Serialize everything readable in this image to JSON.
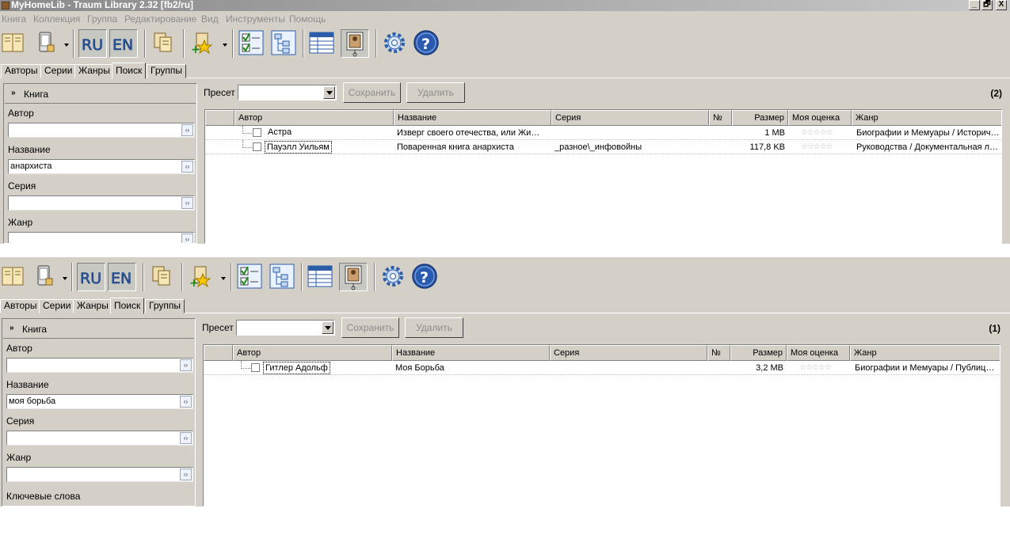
{
  "window": {
    "title": "MyHomeLib - Traum Library 2.32 [fb2/ru]",
    "minimize": "_",
    "restore": "🗗",
    "close": "X"
  },
  "menu": [
    "Книга",
    "Коллекция",
    "Группа",
    "Редактирование",
    "Вид",
    "Инструменты",
    "Помощь"
  ],
  "toolbar": {
    "lang_ru": "RU",
    "lang_en": "EN",
    "help": "?",
    "icons": [
      "book-icon",
      "device-icon",
      "ru-language-icon",
      "en-language-icon",
      "copy-icon",
      "add-favorite-icon",
      "check-list-icon",
      "tree-view-icon",
      "table-view-icon",
      "cover-view-icon",
      "settings-gear-icon",
      "help-icon"
    ]
  },
  "tabs": [
    "Авторы",
    "Серии",
    "Жанры",
    "Поиск",
    "Группы"
  ],
  "columns": {
    "author": "Автор",
    "title": "Название",
    "series": "Серия",
    "num": "№",
    "size": "Размер",
    "rating": "Моя оценка",
    "genre": "Жанр"
  },
  "panes": [
    {
      "left_header": "Книга",
      "fields": [
        {
          "label": "Автор",
          "value": ""
        },
        {
          "label": "Название",
          "value": "анархиста"
        },
        {
          "label": "Серия",
          "value": ""
        },
        {
          "label": "Жанр",
          "value": ""
        }
      ],
      "preset_label": "Пресет",
      "save_label": "Сохранить",
      "delete_label": "Удалить",
      "count": "(2)",
      "rows": [
        {
          "author": "Астра",
          "title": "Изверг своего отечества, или Жи…",
          "series": "",
          "num": "",
          "size": "1 MB",
          "rating": "☆☆☆☆☆",
          "genre": "Биографии и Мемуары / Историчес…"
        },
        {
          "author": "Пауэлл Уильям",
          "title": "Поваренная книга анархиста",
          "series": "_разное\\_инфовойны",
          "num": "",
          "size": "117,8 KB",
          "rating": "☆☆☆☆☆",
          "genre": "Руководства / Документальная л…"
        }
      ]
    },
    {
      "left_header": "Книга",
      "fields": [
        {
          "label": "Автор",
          "value": ""
        },
        {
          "label": "Название",
          "value": "моя борьба"
        },
        {
          "label": "Серия",
          "value": ""
        },
        {
          "label": "Жанр",
          "value": ""
        },
        {
          "label": "Ключевые слова",
          "value": ""
        }
      ],
      "preset_label": "Пресет",
      "save_label": "Сохранить",
      "delete_label": "Удалить",
      "count": "(1)",
      "rows": [
        {
          "author": "Гитлер Адольф",
          "title": "Моя Борьба",
          "series": "",
          "num": "",
          "size": "3,2 MB",
          "rating": "☆☆☆☆☆",
          "genre": "Биографии и Мемуары / Публицис…"
        }
      ]
    }
  ]
}
